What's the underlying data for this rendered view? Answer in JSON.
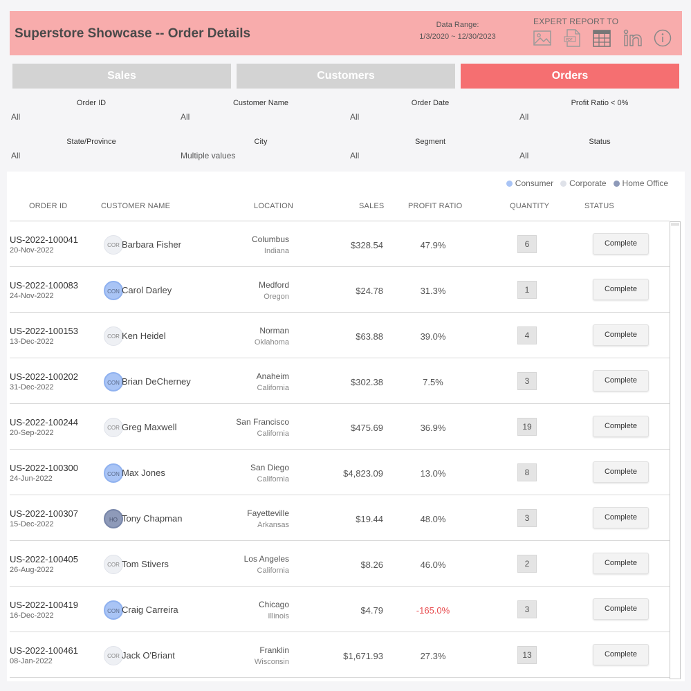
{
  "header": {
    "title": "Superstore Showcase -- Order Details",
    "range_label": "Data Range:",
    "range_value": "1/3/2020 ~ 12/30/2023",
    "export_label": "EXPERT REPORT TO",
    "export_icons": [
      "image-icon",
      "pdf-icon",
      "crosstab-icon",
      "linkedin-icon",
      "info-icon"
    ]
  },
  "tabs": [
    {
      "label": "Sales",
      "active": false
    },
    {
      "label": "Customers",
      "active": false
    },
    {
      "label": "Orders",
      "active": true
    }
  ],
  "filters": [
    {
      "label": "Order ID",
      "value": "All"
    },
    {
      "label": "Customer Name",
      "value": "All"
    },
    {
      "label": "Order Date",
      "value": "All"
    },
    {
      "label": "Profit Ratio < 0%",
      "value": "All"
    },
    {
      "label": "State/Province",
      "value": "All"
    },
    {
      "label": "City",
      "value": "Multiple values"
    },
    {
      "label": "Segment",
      "value": "All"
    },
    {
      "label": "Status",
      "value": "All"
    }
  ],
  "legend": [
    {
      "label": "Consumer",
      "color": "#a9c4f5"
    },
    {
      "label": "Corporate",
      "color": "#dfe2e9"
    },
    {
      "label": "Home Office",
      "color": "#8e9ab9"
    }
  ],
  "columns": {
    "order_id": "ORDER ID",
    "customer_name": "CUSTOMER NAME",
    "location": "LOCATION",
    "sales": "SALES",
    "profit_ratio": "PROFIT RATIO",
    "quantity": "QUANTITY",
    "status": "STATUS"
  },
  "rows": [
    {
      "order_id": "US-2022-100041",
      "date": "20-Nov-2022",
      "segment": "COR",
      "customer": "Barbara Fisher",
      "city": "Columbus",
      "state": "Indiana",
      "sales": "$328.54",
      "ratio": "47.9%",
      "qty": "6",
      "status": "Complete"
    },
    {
      "order_id": "US-2022-100083",
      "date": "24-Nov-2022",
      "segment": "CON",
      "customer": "Carol Darley",
      "city": "Medford",
      "state": "Oregon",
      "sales": "$24.78",
      "ratio": "31.3%",
      "qty": "1",
      "status": "Complete"
    },
    {
      "order_id": "US-2022-100153",
      "date": "13-Dec-2022",
      "segment": "COR",
      "customer": "Ken Heidel",
      "city": "Norman",
      "state": "Oklahoma",
      "sales": "$63.88",
      "ratio": "39.0%",
      "qty": "4",
      "status": "Complete"
    },
    {
      "order_id": "US-2022-100202",
      "date": "31-Dec-2022",
      "segment": "CON",
      "customer": "Brian DeCherney",
      "city": "Anaheim",
      "state": "California",
      "sales": "$302.38",
      "ratio": "7.5%",
      "qty": "3",
      "status": "Complete"
    },
    {
      "order_id": "US-2022-100244",
      "date": "20-Sep-2022",
      "segment": "COR",
      "customer": "Greg Maxwell",
      "city": "San Francisco",
      "state": "California",
      "sales": "$475.69",
      "ratio": "36.9%",
      "qty": "19",
      "status": "Complete"
    },
    {
      "order_id": "US-2022-100300",
      "date": "24-Jun-2022",
      "segment": "CON",
      "customer": "Max Jones",
      "city": "San Diego",
      "state": "California",
      "sales": "$4,823.09",
      "ratio": "13.0%",
      "qty": "8",
      "status": "Complete"
    },
    {
      "order_id": "US-2022-100307",
      "date": "15-Dec-2022",
      "segment": "HO",
      "customer": "Tony Chapman",
      "city": "Fayetteville",
      "state": "Arkansas",
      "sales": "$19.44",
      "ratio": "48.0%",
      "qty": "3",
      "status": "Complete"
    },
    {
      "order_id": "US-2022-100405",
      "date": "26-Aug-2022",
      "segment": "COR",
      "customer": "Tom Stivers",
      "city": "Los Angeles",
      "state": "California",
      "sales": "$8.26",
      "ratio": "46.0%",
      "qty": "2",
      "status": "Complete"
    },
    {
      "order_id": "US-2022-100419",
      "date": "16-Dec-2022",
      "segment": "CON",
      "customer": "Craig Carreira",
      "city": "Chicago",
      "state": "Illinois",
      "sales": "$4.79",
      "ratio": "-165.0%",
      "qty": "3",
      "status": "Complete"
    },
    {
      "order_id": "US-2022-100461",
      "date": "08-Jan-2022",
      "segment": "COR",
      "customer": "Jack O'Briant",
      "city": "Franklin",
      "state": "Wisconsin",
      "sales": "$1,671.93",
      "ratio": "27.3%",
      "qty": "13",
      "status": "Complete"
    }
  ]
}
